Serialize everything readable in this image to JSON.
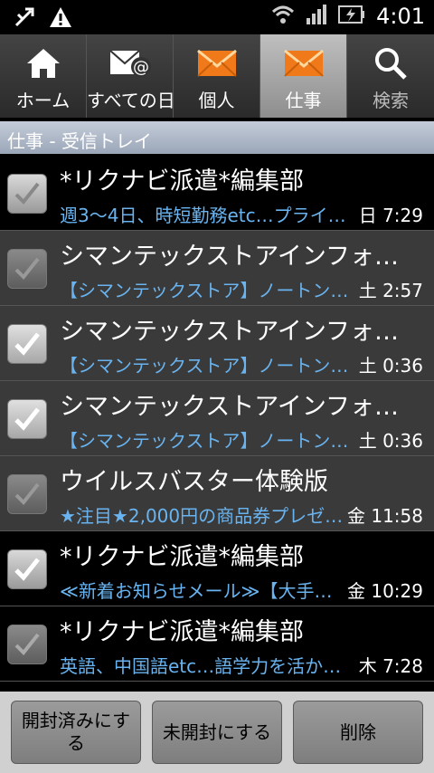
{
  "status_bar": {
    "time": "4:01"
  },
  "tabs": [
    {
      "label": "ホーム",
      "icon": "home-icon"
    },
    {
      "label": "すべての日",
      "icon": "all-mail-icon"
    },
    {
      "label": "個人",
      "icon": "mail-icon"
    },
    {
      "label": "仕事",
      "icon": "mail-icon",
      "active": true
    },
    {
      "label": "検索",
      "icon": "search-icon"
    }
  ],
  "folder_title": "仕事 - 受信トレイ",
  "messages": [
    {
      "sender": "*リクナビ派遣*編集部",
      "snippet": "週3～4日、時短勤務etc…プライ…",
      "time": "日 7:29",
      "checked": false,
      "read": false
    },
    {
      "sender": "シマンテックストアインフォ…",
      "snippet": "【シマンテックストア】ノートン…",
      "time": "土 2:57",
      "checked": false,
      "read": true
    },
    {
      "sender": "シマンテックストアインフォ…",
      "snippet": "【シマンテックストア】ノートン…",
      "time": "土 0:36",
      "checked": true,
      "read": true
    },
    {
      "sender": "シマンテックストアインフォ…",
      "snippet": "【シマンテックストア】ノートン…",
      "time": "土 0:36",
      "checked": true,
      "read": true
    },
    {
      "sender": "ウイルスバスター体験版",
      "snippet": "★注目★2,000円の商品券プレゼ…",
      "time": "金 11:58",
      "checked": false,
      "read": true
    },
    {
      "sender": "*リクナビ派遣*編集部",
      "snippet": "≪新着お知らせメール≫【大手…",
      "time": "金 10:29",
      "checked": true,
      "read": false
    },
    {
      "sender": "*リクナビ派遣*編集部",
      "snippet": "英語、中国語etc…語学力を活かせ…",
      "time": "木 7:28",
      "checked": false,
      "read": false
    }
  ],
  "buttons": {
    "mark_read": "開封済みにする",
    "mark_unread": "未開封にする",
    "delete": "削除"
  },
  "colors": {
    "snippet": "#69b4f0",
    "active_tab": "#a8a8a8",
    "header": "#aab4c4"
  }
}
